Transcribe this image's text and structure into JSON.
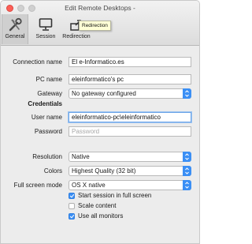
{
  "window": {
    "title": "Edit Remote Desktops -"
  },
  "tabs": [
    {
      "label": "General",
      "icon": "wrench-screwdriver-icon"
    },
    {
      "label": "Session",
      "icon": "monitor-icon"
    },
    {
      "label": "Redirection",
      "icon": "redirection-icon"
    }
  ],
  "tooltip": {
    "text": "Redirection"
  },
  "form": {
    "connection_name": {
      "label": "Connection name",
      "value": "El e-Informatico.es"
    },
    "pc_name": {
      "label": "PC name",
      "value": "eleinformatico's pc"
    },
    "gateway": {
      "label": "Gateway",
      "value": "No gateway configured"
    },
    "credentials_heading": "Credentials",
    "user_name": {
      "label": "User name",
      "value": "eleinformatico-pc\\eleinformatico"
    },
    "password": {
      "label": "Password",
      "placeholder": "Password"
    },
    "resolution": {
      "label": "Resolution",
      "value": "Native"
    },
    "colors": {
      "label": "Colors",
      "value": "Highest Quality (32 bit)"
    },
    "full_screen_mode": {
      "label": "Full screen mode",
      "value": "OS X native"
    },
    "checkboxes": [
      {
        "label": "Start session in full screen",
        "checked": true
      },
      {
        "label": "Scale content",
        "checked": false
      },
      {
        "label": "Use all monitors",
        "checked": true
      }
    ]
  },
  "colors": {
    "accent": "#3b8ff5",
    "close": "#fc5f57"
  }
}
